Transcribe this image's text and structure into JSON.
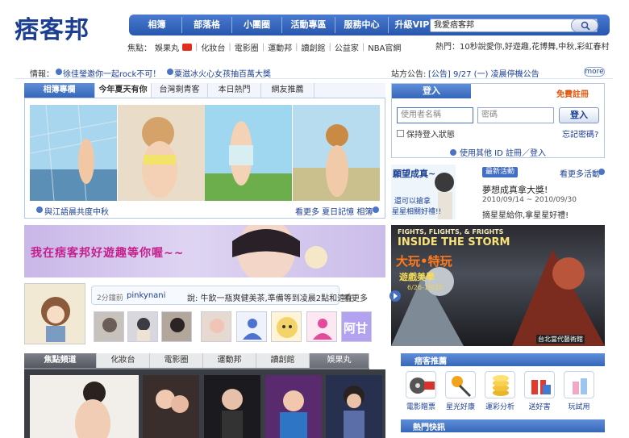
{
  "header": {
    "logo_text": "痞客邦",
    "nav": [
      "相簿",
      "部落格",
      "小團圈",
      "活動專區",
      "服務中心",
      "升級VIP"
    ],
    "search_value": "我愛痞客邦",
    "focus_label": "焦點：",
    "focus_items": [
      "娛果丸",
      "化妝台",
      "電影圈",
      "運動邦",
      "讀創館",
      "公益家",
      "NBA官網"
    ],
    "hot_label": "熱門：",
    "hot_value": "10秒說愛你,好遊趣,花博舞,中秋,彩虹春村"
  },
  "info": {
    "label": "情報：",
    "news": [
      "徐佳瑩邀你一起rock不可！",
      "粟滋冰火心女孩抽百萬大獎"
    ],
    "notice_label": "站方公告:",
    "notice": "[公告] 9/27 (一) 凌晨停機公告",
    "more": "more"
  },
  "album": {
    "tabs": [
      "相簿專欄",
      "今年夏天有你",
      "台灣剩青客",
      "本日熱門",
      "網友推薦"
    ],
    "caption": "與江語晨共度中秋",
    "more": "看更多 夏日記憶 相簿"
  },
  "login": {
    "title": "登入",
    "register": "免費註冊",
    "user_placeholder": "使用者名稱",
    "pass_placeholder": "密碼",
    "login_button": "登入",
    "remember": "保持登入狀態",
    "forgot": "忘記密碼?",
    "other_id": "使用其他 ID 註冊／登入"
  },
  "event": {
    "image_text": "願望成真~",
    "image_sub": [
      "還可以搶拿",
      "星星相關好禮!!"
    ],
    "tag": "最新活動",
    "more": "看更多活動",
    "title": "夢想成真拿大獎!",
    "date": "2010/09/14 ~ 2010/09/30",
    "desc": "摘星星給你,拿星星好禮!"
  },
  "banner": {
    "text": "我在痞客邦好遊趣等你喔~~"
  },
  "game": {
    "top": "FIGHTS, FLIGHTS, & FRIGHTS",
    "title": "INSIDE THE STORM",
    "cn_title": "大玩•特玩",
    "cn_sub": "遊戲美學",
    "date": "6/26-10/10",
    "footer": "台北當代藝術館"
  },
  "status": {
    "time": "2分鐘前",
    "user": "pinkynani",
    "text": "說: 牛飲一瓶爽健美茶,準備等到凌晨2點和遠在",
    "more": "看更多",
    "thumb_text": "阿甘"
  },
  "channel": {
    "tabs": [
      "焦點頻道",
      "化妝台",
      "電影圈",
      "運動邦",
      "讀創館",
      "娛果丸"
    ]
  },
  "recommend": {
    "title": "痞客推薦",
    "items": [
      "電影贈票",
      "星光好康",
      "運彩分析",
      "送好害",
      "玩試用"
    ]
  },
  "hot_news": {
    "title": "熱門快訊"
  },
  "colors": {
    "brand": "#1c3f94",
    "nav": "#2857ad",
    "accent": "#e3560a",
    "banner_text": "#c51f8c"
  }
}
